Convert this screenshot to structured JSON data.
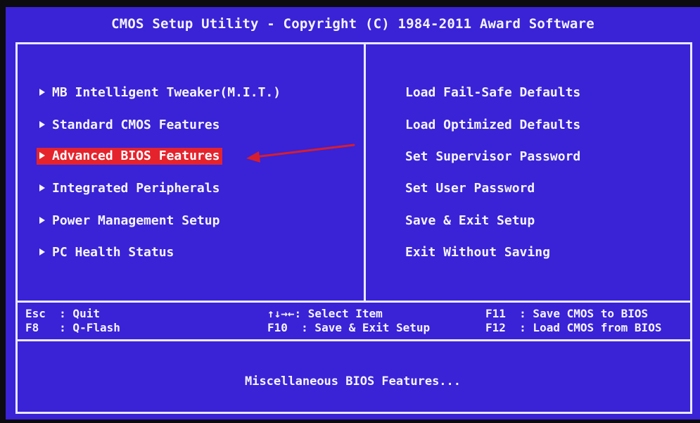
{
  "header": {
    "title": "CMOS Setup Utility - Copyright (C) 1984-2011 Award Software"
  },
  "left_menu": [
    {
      "label": "MB Intelligent Tweaker(M.I.T.)",
      "selected": false
    },
    {
      "label": "Standard CMOS Features",
      "selected": false
    },
    {
      "label": "Advanced BIOS Features",
      "selected": true
    },
    {
      "label": "Integrated Peripherals",
      "selected": false
    },
    {
      "label": "Power Management Setup",
      "selected": false
    },
    {
      "label": "PC Health Status",
      "selected": false
    }
  ],
  "right_menu": [
    {
      "label": "Load Fail-Safe Defaults"
    },
    {
      "label": "Load Optimized Defaults"
    },
    {
      "label": "Set Supervisor Password"
    },
    {
      "label": "Set User Password"
    },
    {
      "label": "Save & Exit Setup"
    },
    {
      "label": "Exit Without Saving"
    }
  ],
  "help_bar": {
    "col1": [
      "Esc  : Quit",
      "F8   : Q-Flash"
    ],
    "col2": [
      "↑↓→←: Select Item",
      "F10  : Save & Exit Setup"
    ],
    "col3": [
      "F11  : Save CMOS to BIOS",
      "F12  : Load CMOS from BIOS"
    ]
  },
  "description": "Miscellaneous BIOS Features...",
  "colors": {
    "background": "#3a22d6",
    "selection": "#e5232d",
    "text": "#f4f4ff",
    "annotation_arrow": "#d61e2e"
  },
  "icons": {
    "menu_marker": "triangle-right-icon",
    "annotation": "red-arrow-icon"
  }
}
